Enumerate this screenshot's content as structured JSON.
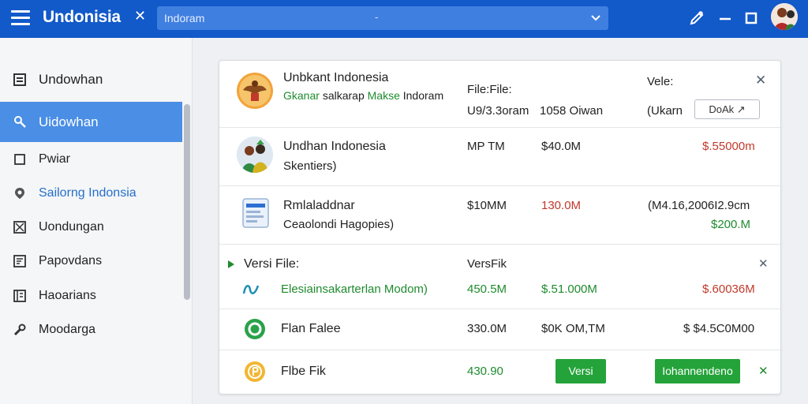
{
  "header": {
    "title": "Undonisia",
    "search_value": "Indoram",
    "search_dash": "-"
  },
  "sidebar": {
    "items": [
      {
        "label": "Undowhan",
        "icon": "list-icon"
      },
      {
        "label": "Uidowhan",
        "icon": "wrench-icon"
      },
      {
        "label": "Pwiar",
        "icon": "square-icon"
      },
      {
        "label": "Sailorng Indonsia",
        "icon": "location-pin-icon"
      },
      {
        "label": "Uondungan",
        "icon": "checkbox-icon"
      },
      {
        "label": "Papovdans",
        "icon": "document-icon"
      },
      {
        "label": "Haoarians",
        "icon": "notebook-icon"
      },
      {
        "label": "Moodarga",
        "icon": "tools-icon"
      }
    ]
  },
  "rows": [
    {
      "title": "Unbkant Indonesia",
      "subtitle_green": "Gkanar",
      "subtitle_mid": "salkarap",
      "subtitle_green2": "Makse",
      "subtitle_end": "Indoram",
      "file_header": "File:File:",
      "file_value": "U9/3.3oram",
      "size_value": "1058 Oiwan",
      "version_header": "Vele:",
      "version_value": "(Ukarn",
      "action_label": "DoAk"
    },
    {
      "title": "Undhan Indonesia",
      "subtitle": "Skentiers)",
      "col1": "MP TM",
      "col2": "$40.0M",
      "col3": "$.55000m"
    },
    {
      "title": "Rmlaladdnar",
      "subtitle": "Ceaolondi Hagopies)",
      "col1": "$10MM",
      "col2": "130.0M",
      "col3": "(M4.16,2006I2.9cm",
      "col3b": "$200.M"
    },
    {
      "section_title": "Versi File:",
      "section_col": "VersFik"
    },
    {
      "title": "Elesiainsakarterlan Modom)",
      "col1": "450.5M",
      "col2": "$.51.000M",
      "col3": "$.60036M"
    },
    {
      "title": "Flan Falee",
      "col1": "330.0M",
      "col2": "$0K OM,TM",
      "col3": "$ $4.5C0M00"
    },
    {
      "title": "Flbe Fik",
      "col1": "430.90",
      "button1": "Versi",
      "button2": "Iohannendeno"
    }
  ],
  "colors": {
    "topbar": "#1259c9",
    "active_sidebar": "#4a8ee5",
    "green": "#1e8b2e",
    "red": "#c0392b"
  }
}
